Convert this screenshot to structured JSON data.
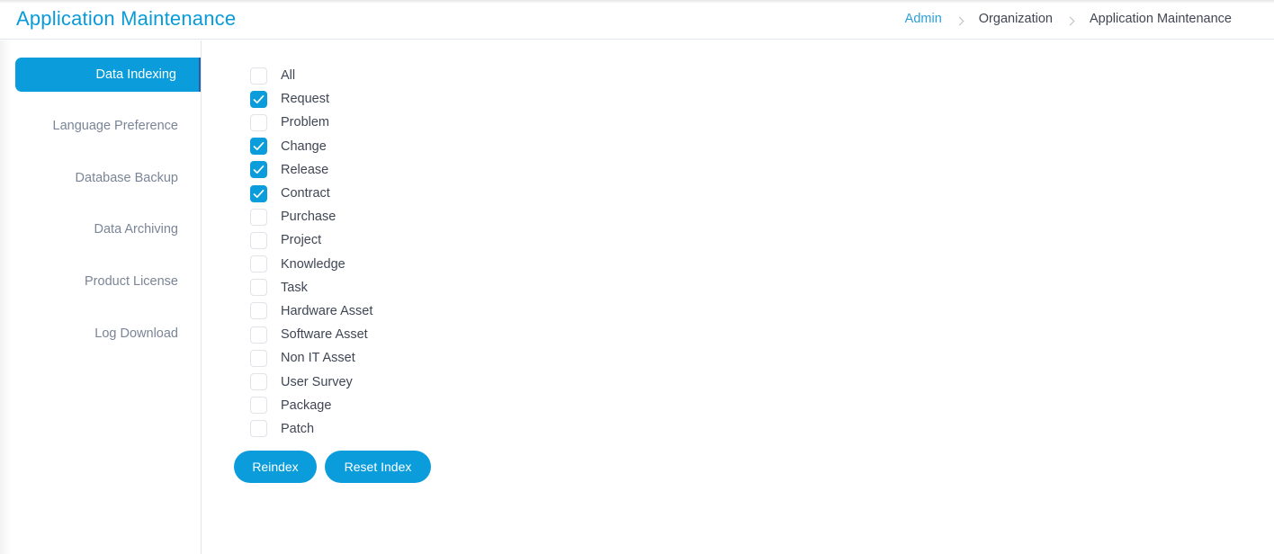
{
  "header": {
    "title": "Application Maintenance",
    "breadcrumb": [
      {
        "label": "Admin",
        "link": true
      },
      {
        "label": "Organization",
        "link": false
      },
      {
        "label": "Application Maintenance",
        "link": false
      }
    ]
  },
  "sidebar": {
    "items": [
      {
        "label": "Data Indexing",
        "active": true
      },
      {
        "label": "Language Preference",
        "active": false
      },
      {
        "label": "Database Backup",
        "active": false
      },
      {
        "label": "Data Archiving",
        "active": false
      },
      {
        "label": "Product License",
        "active": false
      },
      {
        "label": "Log Download",
        "active": false
      }
    ]
  },
  "data_indexing": {
    "modules": [
      {
        "label": "All",
        "checked": false
      },
      {
        "label": "Request",
        "checked": true
      },
      {
        "label": "Problem",
        "checked": false
      },
      {
        "label": "Change",
        "checked": true
      },
      {
        "label": "Release",
        "checked": true
      },
      {
        "label": "Contract",
        "checked": true
      },
      {
        "label": "Purchase",
        "checked": false
      },
      {
        "label": "Project",
        "checked": false
      },
      {
        "label": "Knowledge",
        "checked": false
      },
      {
        "label": "Task",
        "checked": false
      },
      {
        "label": "Hardware Asset",
        "checked": false
      },
      {
        "label": "Software Asset",
        "checked": false
      },
      {
        "label": "Non IT Asset",
        "checked": false
      },
      {
        "label": "User Survey",
        "checked": false
      },
      {
        "label": "Package",
        "checked": false
      },
      {
        "label": "Patch",
        "checked": false
      }
    ],
    "buttons": {
      "reindex": "Reindex",
      "reset_index": "Reset Index"
    }
  },
  "colors": {
    "accent": "#0b9ddb",
    "title": "#099bd9",
    "text": "#3f4654",
    "muted": "#7a8597"
  }
}
